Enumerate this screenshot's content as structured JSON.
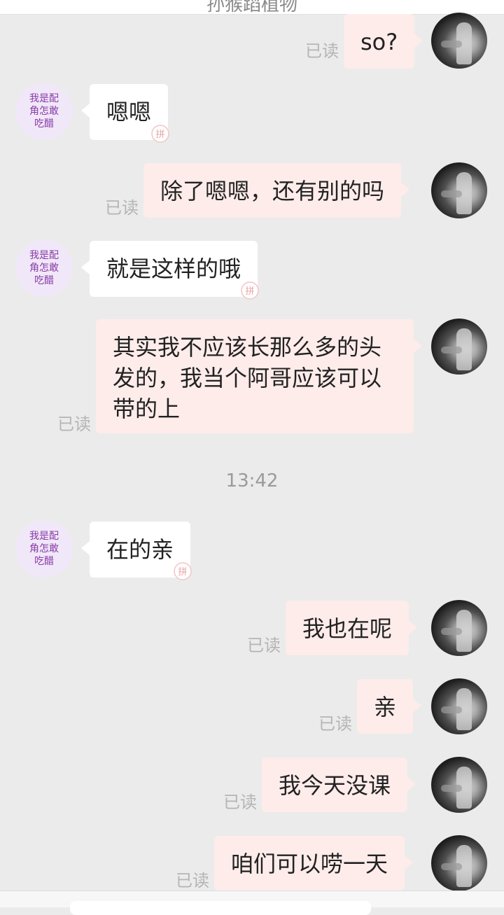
{
  "header": {
    "title": "孙猴蹈植物"
  },
  "contact": {
    "avatar_text": "我是配角怎敢吃醋"
  },
  "read_label": "已读",
  "messages": [
    {
      "side": "right",
      "text": "so?"
    },
    {
      "side": "left",
      "text": "嗯嗯"
    },
    {
      "side": "right",
      "text": "除了嗯嗯，还有别的吗"
    },
    {
      "side": "left",
      "text": "就是这样的哦"
    },
    {
      "side": "right",
      "text": "其实我不应该长那么多的头发的，我当个阿哥应该可以带的上"
    },
    {
      "side": "left",
      "text": "在的亲"
    },
    {
      "side": "right",
      "text": "我也在呢"
    },
    {
      "side": "right",
      "text": "亲"
    },
    {
      "side": "right",
      "text": "我今天没课"
    },
    {
      "side": "right",
      "text": "咱们可以唠一天"
    }
  ],
  "timestamp": "13:42",
  "colors": {
    "background": "#ebebeb",
    "my_bubble": "#fdecea",
    "their_bubble": "#ffffff",
    "read_text": "#b5b5b5",
    "avatar_text": "#8a3aa8"
  }
}
